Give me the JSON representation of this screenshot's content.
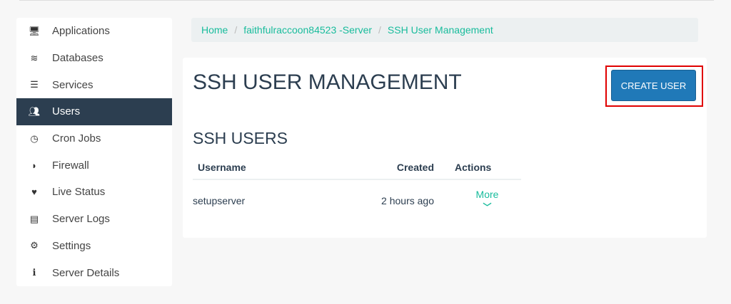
{
  "sidebar": {
    "items": [
      {
        "label": "Applications",
        "icon": "monitor-icon",
        "active": false
      },
      {
        "label": "Databases",
        "icon": "database-icon",
        "active": false
      },
      {
        "label": "Services",
        "icon": "server-icon",
        "active": false
      },
      {
        "label": "Users",
        "icon": "users-icon",
        "active": true
      },
      {
        "label": "Cron Jobs",
        "icon": "clock-icon",
        "active": false
      },
      {
        "label": "Firewall",
        "icon": "shield-icon",
        "active": false
      },
      {
        "label": "Live Status",
        "icon": "heartbeat-icon",
        "active": false
      },
      {
        "label": "Server Logs",
        "icon": "file-icon",
        "active": false
      },
      {
        "label": "Settings",
        "icon": "cogs-icon",
        "active": false
      },
      {
        "label": "Server Details",
        "icon": "info-icon",
        "active": false
      }
    ]
  },
  "breadcrumb": [
    "Home",
    "faithfulraccoon84523 -Server",
    "SSH User Management"
  ],
  "main": {
    "title": "SSH USER MANAGEMENT",
    "create_button": "CREATE USER",
    "section_title": "SSH USERS",
    "table": {
      "headers": [
        "Username",
        "Created",
        "Actions"
      ],
      "rows": [
        {
          "username": "setupserver",
          "created": "2 hours ago",
          "action": "More"
        }
      ]
    }
  },
  "colors": {
    "accent": "#18bc9c",
    "primary": "#2079b8",
    "sidebar_active": "#2c3e50",
    "highlight": "#e00000"
  }
}
